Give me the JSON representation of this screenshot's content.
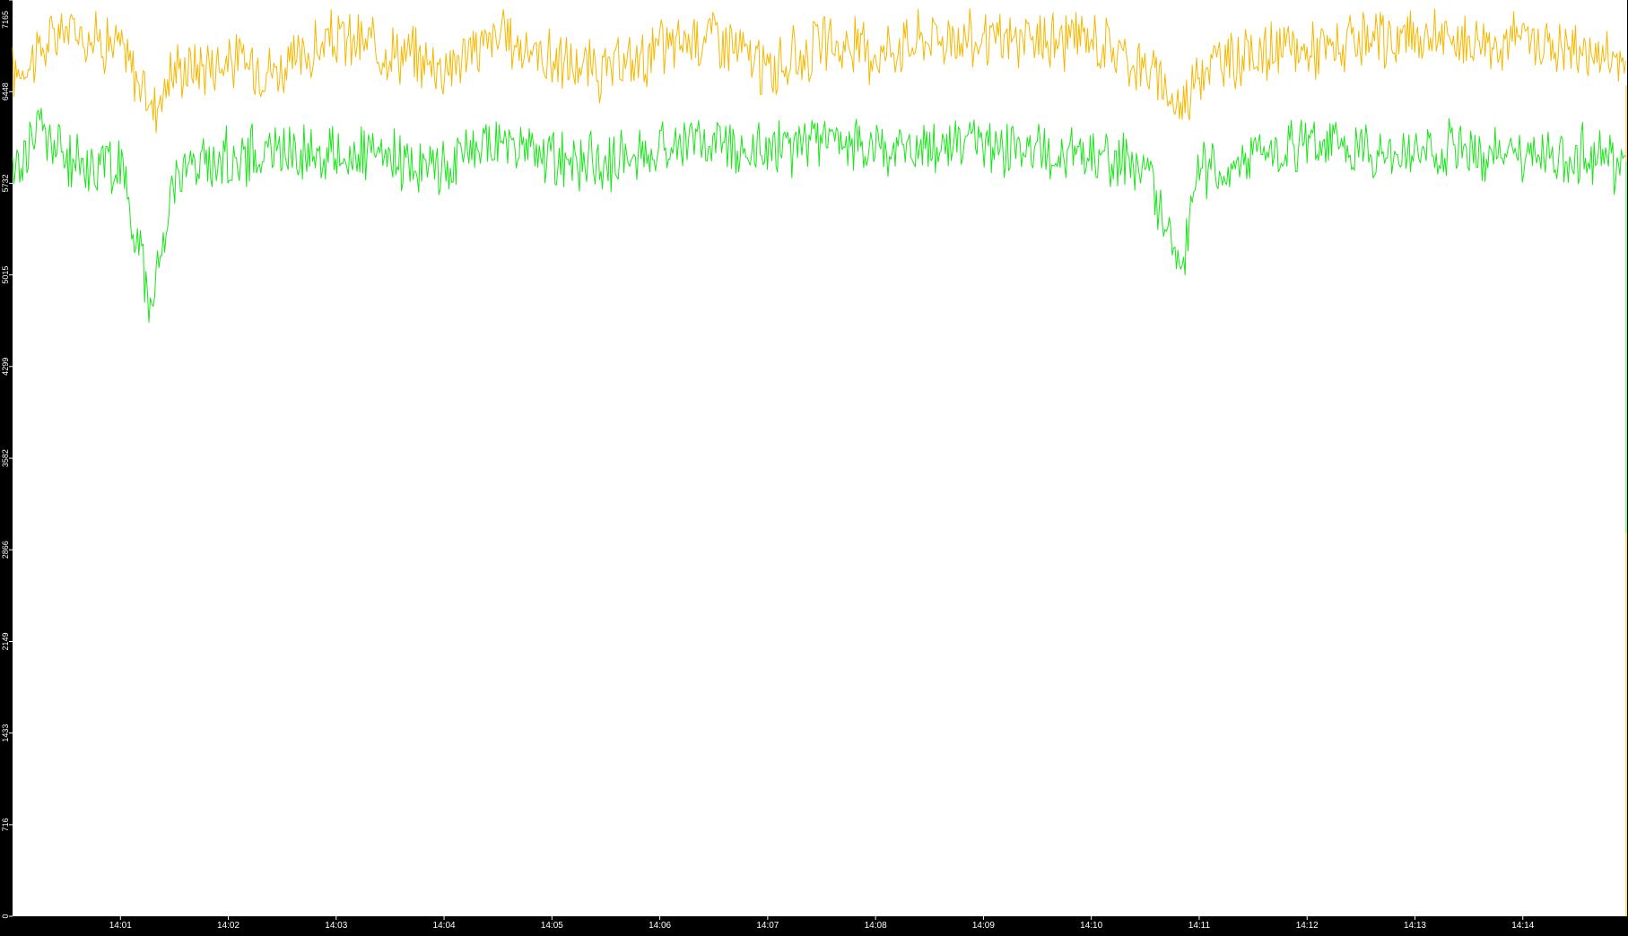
{
  "chart_data": {
    "type": "line",
    "title": "",
    "xlabel": "",
    "ylabel": "",
    "ylim": [
      0,
      7165
    ],
    "y_ticks": [
      0,
      716,
      1433,
      2149,
      2866,
      3582,
      4299,
      5015,
      5732,
      6448,
      7165
    ],
    "x_ticks": [
      "14:01",
      "14:02",
      "14:03",
      "14:04",
      "14:05",
      "14:06",
      "14:07",
      "14:08",
      "14:09",
      "14:10",
      "14:11",
      "14:12",
      "14:13",
      "14:14"
    ],
    "x_range": [
      "14:00:00",
      "14:14:58"
    ],
    "grid": false,
    "legend": "none",
    "series": [
      {
        "color": "#f5b800",
        "times": [
          "14:00:00",
          "14:00:30",
          "14:01:00",
          "14:01:18",
          "14:01:30",
          "14:02:00",
          "14:02:30",
          "14:03:00",
          "14:03:30",
          "14:04:00",
          "14:04:30",
          "14:05:00",
          "14:05:30",
          "14:06:00",
          "14:06:30",
          "14:07:00",
          "14:07:30",
          "14:08:00",
          "14:08:30",
          "14:09:00",
          "14:09:30",
          "14:10:00",
          "14:10:30",
          "14:10:50",
          "14:11:00",
          "14:11:30",
          "14:12:00",
          "14:12:30",
          "14:13:00",
          "14:13:30",
          "14:14:00",
          "14:14:30",
          "14:14:50"
        ],
        "values": [
          6580,
          6950,
          6800,
          6320,
          6620,
          6700,
          6620,
          6860,
          6780,
          6650,
          6880,
          6700,
          6580,
          6780,
          6920,
          6600,
          6820,
          6760,
          6890,
          6840,
          6840,
          6870,
          6640,
          6320,
          6640,
          6740,
          6780,
          6800,
          6880,
          6840,
          6860,
          6780,
          6700
        ]
      },
      {
        "color": "#19e619",
        "times": [
          "14:00:00",
          "14:00:15",
          "14:00:30",
          "14:01:00",
          "14:01:18",
          "14:01:30",
          "14:02:00",
          "14:02:30",
          "14:03:00",
          "14:03:30",
          "14:04:00",
          "14:04:30",
          "14:05:00",
          "14:05:30",
          "14:06:00",
          "14:06:30",
          "14:07:00",
          "14:07:30",
          "14:08:00",
          "14:08:30",
          "14:09:00",
          "14:09:30",
          "14:10:00",
          "14:10:30",
          "14:10:50",
          "14:11:00",
          "14:11:30",
          "14:12:00",
          "14:12:30",
          "14:13:00",
          "14:13:30",
          "14:14:00",
          "14:14:30",
          "14:14:50"
        ],
        "values": [
          5800,
          6200,
          5900,
          5880,
          4750,
          5830,
          5930,
          5990,
          5960,
          5900,
          5870,
          6060,
          5920,
          5880,
          6020,
          6080,
          5980,
          6060,
          6010,
          6010,
          6040,
          5960,
          5920,
          5890,
          5050,
          5820,
          5960,
          6040,
          6000,
          5980,
          5990,
          5930,
          5980,
          5900
        ]
      }
    ]
  }
}
